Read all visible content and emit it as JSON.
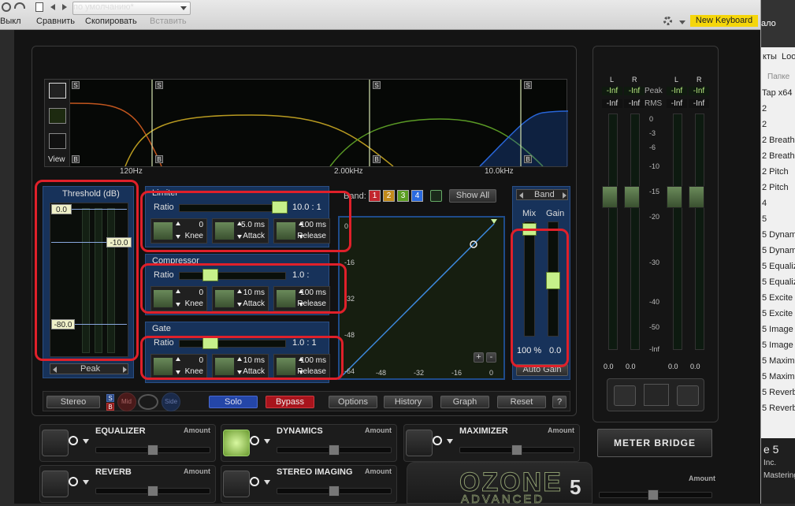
{
  "host": {
    "bypass_label": "Выкл",
    "compare_label": "Сравнить",
    "copy_label": "Скопировать",
    "paste_label": "Вставить",
    "preset": "по умолчанию*",
    "new_keyboard": "New Keyboard",
    "right_tabs": [
      "ало",
      "кты",
      "Loo"
    ],
    "right_folder": "Папке",
    "right_items": [
      "Tap x64",
      "2",
      "2",
      "2 Breath",
      "2 Breath",
      "2 Pitch",
      "2 Pitch",
      "4",
      "5",
      "5 Dynam",
      "5 Dynam",
      "5 Equaliz",
      "5 Equaliz",
      "5 Excite",
      "5 Excite",
      "5 Image",
      "5 Image",
      "5 Maxim",
      "5 Maxim",
      "5 Reverb",
      "5 Reverb"
    ],
    "right_footer": [
      "e 5",
      "Inc.",
      "Mastering"
    ]
  },
  "spectrum": {
    "view_label": "View",
    "freq_labels": [
      "120Hz",
      "2.00kHz",
      "10.0kHz"
    ],
    "solo_marker": "S",
    "bypass_marker": "B",
    "curve_colors": [
      "#c2561e",
      "#b89a20",
      "#5a9a25",
      "#2a6ae0"
    ]
  },
  "threshold": {
    "title": "Threshold (dB)",
    "top_value": "0.0",
    "mid_value": "-10.0",
    "bottom_value": "-80.0",
    "mode": "Peak"
  },
  "limiter": {
    "title": "Limiter",
    "ratio_label": "Ratio",
    "ratio_value": "10.0 : 1",
    "knee_value": "0",
    "knee_label": "Knee",
    "attack_value": "5.0 ms",
    "attack_label": "Attack",
    "release_value": "100 ms",
    "release_label": "Release"
  },
  "compressor": {
    "title": "Compressor",
    "ratio_label": "Ratio",
    "ratio_value": "1.0 :",
    "knee_value": "0",
    "knee_label": "Knee",
    "attack_value": "10 ms",
    "attack_label": "Attack",
    "release_value": "100 ms",
    "release_label": "Release"
  },
  "gate": {
    "title": "Gate",
    "ratio_label": "Ratio",
    "ratio_value": "1.0 : 1",
    "knee_value": "0",
    "knee_label": "Knee",
    "attack_value": "10 ms",
    "attack_label": "Attack",
    "release_value": "100 ms",
    "release_label": "Release"
  },
  "bands": {
    "label": "Band:",
    "items": [
      {
        "label": "1",
        "color": "#c2262e"
      },
      {
        "label": "2",
        "color": "#c28a1a"
      },
      {
        "label": "3",
        "color": "#5c9e22"
      },
      {
        "label": "4",
        "color": "#2a6ae0"
      }
    ],
    "show_all": "Show All"
  },
  "graph": {
    "y_ticks": [
      "0",
      "-16",
      "-32",
      "-48",
      "-64"
    ],
    "x_ticks": [
      "-48",
      "-32",
      "-16",
      "0"
    ],
    "plus": "+",
    "minus": "-"
  },
  "mixgain": {
    "band_label": "Band",
    "mix_label": "Mix",
    "gain_label": "Gain",
    "mix_value": "100 %",
    "gain_value": "0.0",
    "auto_gain": "Auto Gain"
  },
  "bottombar": {
    "stereo": "Stereo",
    "mid": "Mid",
    "side": "Side",
    "solo": "Solo",
    "bypass": "Bypass",
    "options": "Options",
    "history": "History",
    "graph": "Graph",
    "reset": "Reset",
    "help": "?"
  },
  "modules": [
    {
      "name": "EQUALIZER",
      "amount": "Amount"
    },
    {
      "name": "DYNAMICS",
      "amount": "Amount"
    },
    {
      "name": "MAXIMIZER",
      "amount": "Amount"
    },
    {
      "name": "REVERB",
      "amount": "Amount"
    },
    {
      "name": "STEREO IMAGING",
      "amount": "Amount"
    }
  ],
  "meter": {
    "headers": [
      "L",
      "R",
      "L",
      "R"
    ],
    "peak_label": "Peak",
    "rms_label": "RMS",
    "inf": "-Inf",
    "scale": [
      "0",
      "-3",
      "-6",
      "-10",
      "-15",
      "-20",
      "-30",
      "-40",
      "-50",
      "-Inf"
    ],
    "readouts": [
      "0.0",
      "0.0",
      "0.0",
      "0.0"
    ],
    "bridge_label": "METER BRIDGE",
    "amount": "Amount"
  },
  "branding": {
    "logo": "OZONE",
    "edition": "ADVANCED",
    "version": "5"
  }
}
